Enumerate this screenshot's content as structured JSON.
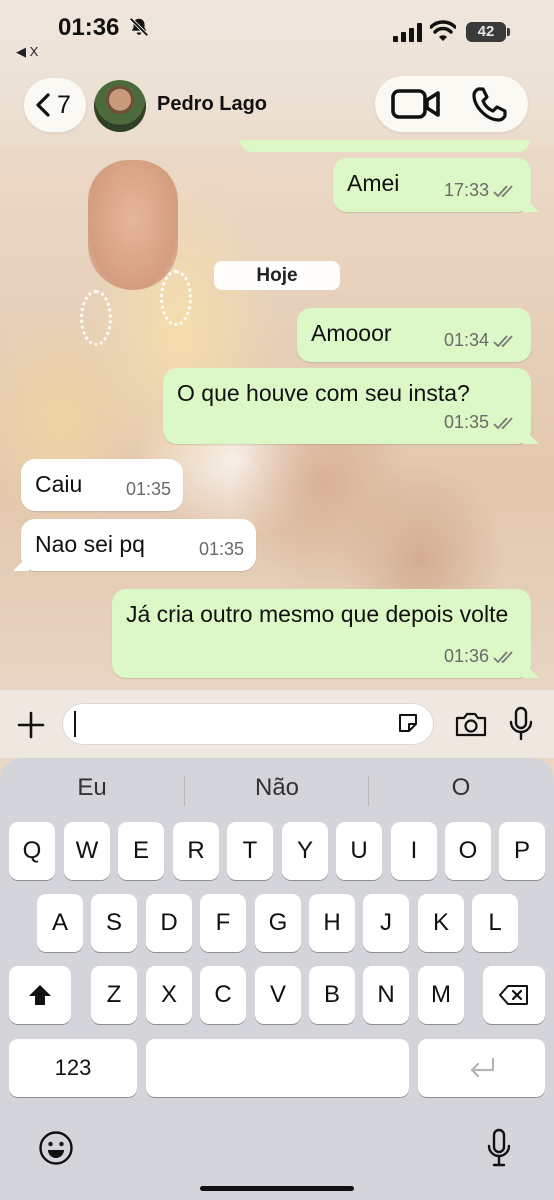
{
  "status_bar": {
    "time": "01:36",
    "back_app_label": "◀ X",
    "battery": "42"
  },
  "header": {
    "back_count": "7",
    "contact_name": "Pedro Lago"
  },
  "messages": [
    {
      "text": "Amei",
      "time": "17:33",
      "direction": "outgoing",
      "read": true
    },
    {
      "text": "Amooor",
      "time": "01:34",
      "direction": "outgoing",
      "read": true
    },
    {
      "text": "O que houve com seu insta?",
      "time": "01:35",
      "direction": "outgoing",
      "read": true
    },
    {
      "text": "Caiu",
      "time": "01:35",
      "direction": "incoming"
    },
    {
      "text": "Nao sei pq",
      "time": "01:35",
      "direction": "incoming"
    },
    {
      "text": "Já cria outro mesmo que depois volte",
      "time": "01:36",
      "direction": "outgoing",
      "read": true
    }
  ],
  "date_separator": "Hoje",
  "input": {
    "value": "",
    "placeholder": ""
  },
  "keyboard": {
    "suggestions": [
      "Eu",
      "Não",
      "O"
    ],
    "row1": [
      "Q",
      "W",
      "E",
      "R",
      "T",
      "Y",
      "U",
      "I",
      "O",
      "P"
    ],
    "row2": [
      "A",
      "S",
      "D",
      "F",
      "G",
      "H",
      "J",
      "K",
      "L"
    ],
    "row3": [
      "Z",
      "X",
      "C",
      "V",
      "B",
      "N",
      "M"
    ],
    "numbers_key": "123"
  },
  "colors": {
    "outgoing_bubble": "#dcf8c6",
    "incoming_bubble": "#ffffff",
    "read_ticks": "#7a7a7a",
    "keyboard_bg": "#d4d5da"
  },
  "icons": [
    "bell-off-icon",
    "signal-icon",
    "wifi-icon",
    "battery-icon",
    "chevron-left-icon",
    "video-call-icon",
    "phone-icon",
    "plus-icon",
    "sticker-icon",
    "camera-icon",
    "microphone-icon",
    "shift-icon",
    "backspace-icon",
    "return-icon",
    "emoji-icon",
    "dictation-icon"
  ]
}
